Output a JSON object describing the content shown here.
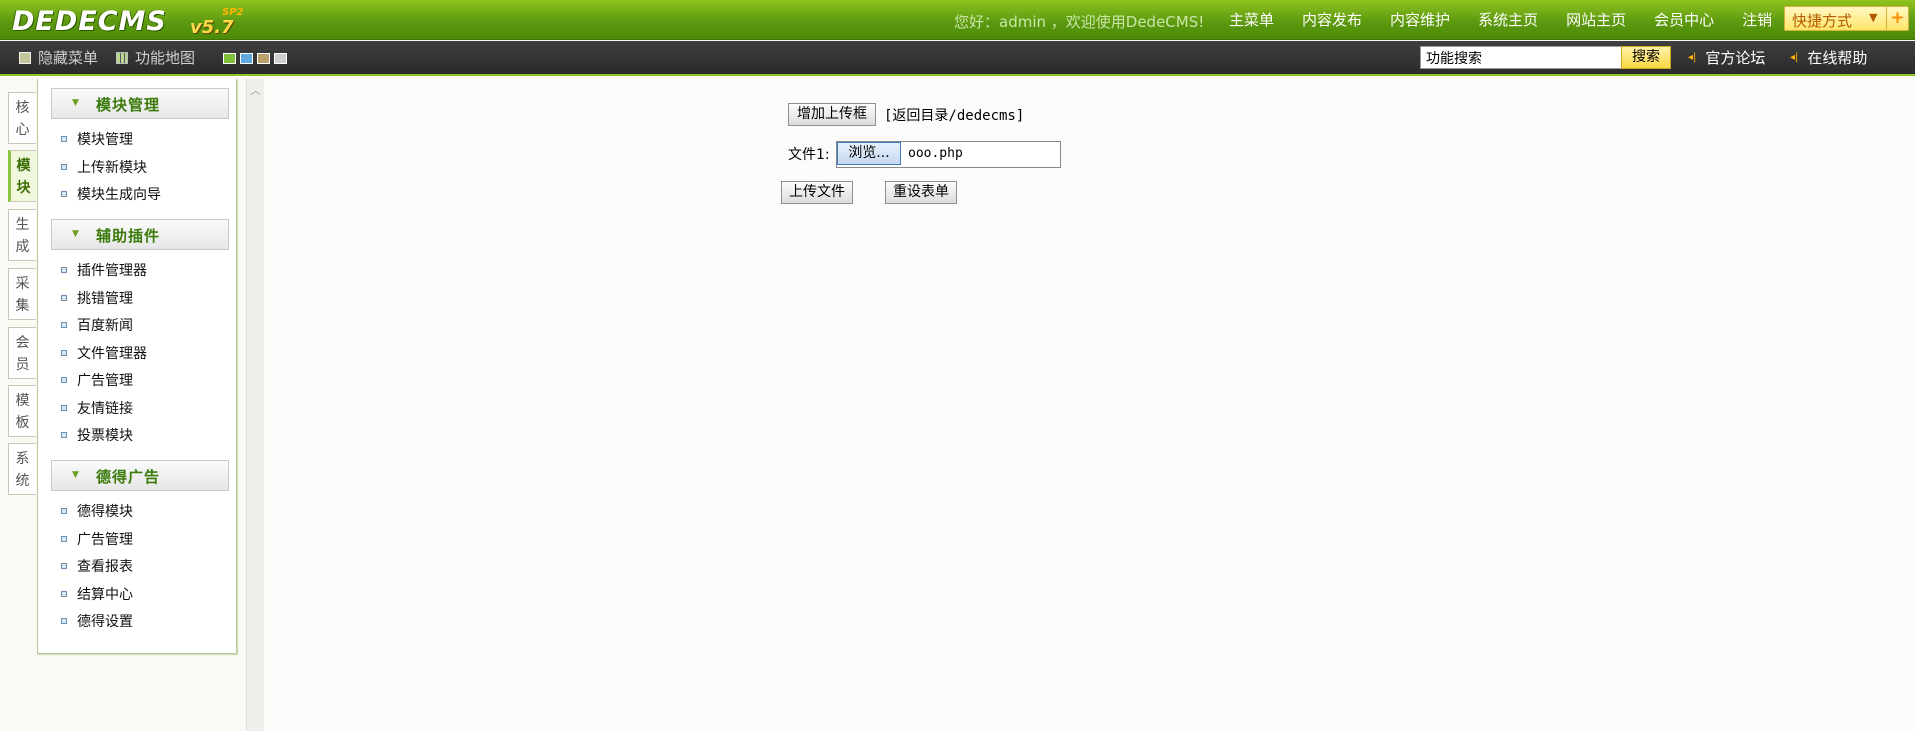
{
  "header": {
    "logo_text": "DEDECMS",
    "logo_version": "v5.7",
    "logo_edition": "SP2",
    "greeting": "您好：admin ，欢迎使用DedeCMS!",
    "nav": [
      "主菜单",
      "内容发布",
      "内容维护",
      "系统主页",
      "网站主页",
      "会员中心",
      "注销"
    ],
    "shortcut_label": "快捷方式",
    "shortcut_caret": "▼",
    "shortcut_plus": "+"
  },
  "toolbar": {
    "hide_menu": "隐藏菜单",
    "function_map": "功能地图",
    "skin_colors": [
      "#7fbf3a",
      "#5fa8e0",
      "#b9a06a",
      "#cfcfcf"
    ],
    "search_value": "功能搜索",
    "search_button": "搜索",
    "forum_link": "官方论坛",
    "help_link": "在线帮助",
    "link_icon": "◂|"
  },
  "vtabs": [
    "核心",
    "模块",
    "生成",
    "采集",
    "会员",
    "模板",
    "系统"
  ],
  "vtabs_active": "模块",
  "sidebar": {
    "groups": [
      {
        "title": "模块管理",
        "items": [
          "模块管理",
          "上传新模块",
          "模块生成向导"
        ]
      },
      {
        "title": "辅助插件",
        "items": [
          "插件管理器",
          "挑错管理",
          "百度新闻",
          "文件管理器",
          "广告管理",
          "友情链接",
          "投票模块"
        ]
      },
      {
        "title": "德得广告",
        "items": [
          "德得模块",
          "广告管理",
          "查看报表",
          "结算中心",
          "德得设置"
        ]
      }
    ]
  },
  "main": {
    "add_upload_button": "增加上传框",
    "return_link": "[返回目录/dedecms]",
    "file_label": "文件1:",
    "browse_button": "浏览...",
    "file_name": "ooo.php",
    "upload_button": "上传文件",
    "reset_button": "重设表单"
  },
  "colors": {
    "header_green": "#6aa814",
    "toolbar_dark": "#333333",
    "accent_yellow": "#f9d843"
  }
}
